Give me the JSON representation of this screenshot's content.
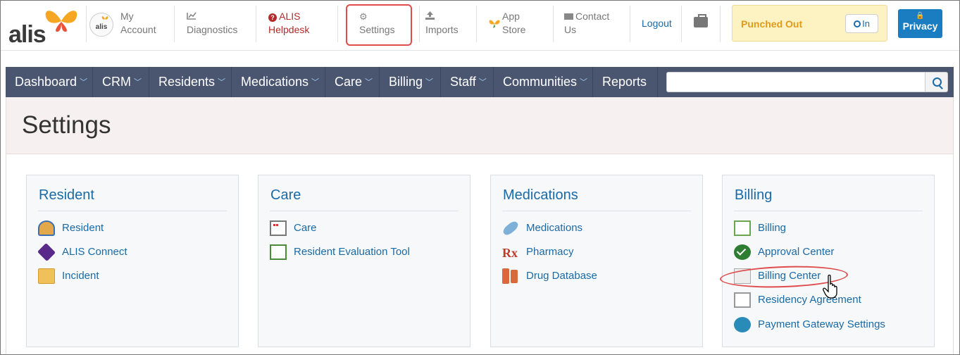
{
  "brand": {
    "logo_text": "alis",
    "avatar_text": "alis"
  },
  "topnav": {
    "my_account": [
      "My",
      "Account"
    ],
    "diagnostics": "Diagnostics",
    "helpdesk": [
      "ALIS",
      "Helpdesk"
    ],
    "settings": "Settings",
    "imports": "Imports",
    "app_store": [
      "App",
      "Store"
    ],
    "contact": [
      "Contact",
      "Us"
    ],
    "logout": "Logout"
  },
  "punch": {
    "status": "Punched Out",
    "button": "In"
  },
  "privacy": {
    "label": "Privacy"
  },
  "menu": {
    "items": [
      {
        "label": "Dashboard",
        "has_dropdown": true
      },
      {
        "label": "CRM",
        "has_dropdown": true
      },
      {
        "label": "Residents",
        "has_dropdown": true
      },
      {
        "label": "Medications",
        "has_dropdown": true
      },
      {
        "label": "Care",
        "has_dropdown": true
      },
      {
        "label": "Billing",
        "has_dropdown": true
      },
      {
        "label": "Staff",
        "has_dropdown": true
      },
      {
        "label": "Communities",
        "has_dropdown": true
      },
      {
        "label": "Reports",
        "has_dropdown": false
      }
    ],
    "search": {
      "value": "",
      "placeholder": ""
    }
  },
  "page": {
    "title": "Settings"
  },
  "panels": [
    {
      "title": "Resident",
      "links": [
        {
          "label": "Resident",
          "icon": "resident-icon"
        },
        {
          "label": "ALIS Connect",
          "icon": "alis-connect-icon"
        },
        {
          "label": "Incident",
          "icon": "incident-folder-icon"
        }
      ]
    },
    {
      "title": "Care",
      "links": [
        {
          "label": "Care",
          "icon": "care-checklist-icon"
        },
        {
          "label": "Resident Evaluation Tool",
          "icon": "evaluation-form-icon"
        }
      ]
    },
    {
      "title": "Medications",
      "links": [
        {
          "label": "Medications",
          "icon": "pill-icon"
        },
        {
          "label": "Pharmacy",
          "icon": "rx-icon"
        },
        {
          "label": "Drug Database",
          "icon": "drug-bottles-icon"
        }
      ]
    },
    {
      "title": "Billing",
      "links": [
        {
          "label": "Billing",
          "icon": "billing-sheet-icon"
        },
        {
          "label": "Approval Center",
          "icon": "approval-check-icon"
        },
        {
          "label": "Billing Center",
          "icon": "billing-center-icon"
        },
        {
          "label": "Residency Agreement",
          "icon": "agreement-doc-icon"
        },
        {
          "label": "Payment Gateway Settings",
          "icon": "globe-gateway-icon"
        }
      ]
    }
  ],
  "colors": {
    "menu_bg": "#4a5570",
    "link": "#1a6aa6",
    "highlight": "#e04b4b",
    "punch_bg": "#fdf2c2",
    "privacy_bg": "#1a7cc1"
  }
}
